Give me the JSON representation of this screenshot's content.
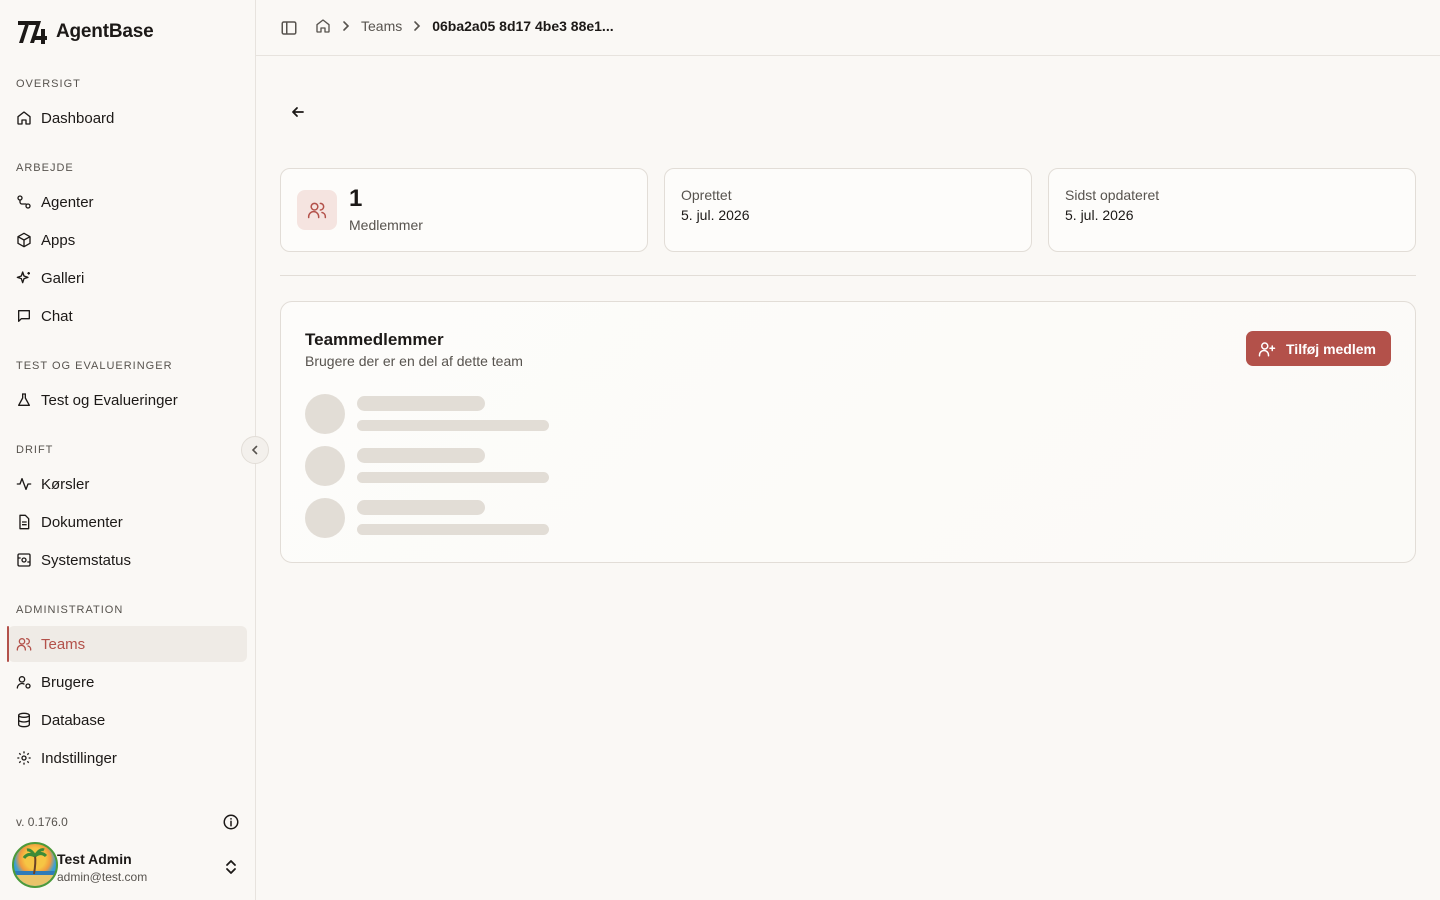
{
  "app": {
    "name": "AgentBase"
  },
  "sidebar": {
    "sections": [
      {
        "label": "OVERSIGT",
        "items": [
          {
            "label": "Dashboard",
            "icon": "home-icon"
          }
        ]
      },
      {
        "label": "ARBEJDE",
        "items": [
          {
            "label": "Agenter",
            "icon": "agents-icon"
          },
          {
            "label": "Apps",
            "icon": "box-icon"
          },
          {
            "label": "Galleri",
            "icon": "sparkles-icon"
          },
          {
            "label": "Chat",
            "icon": "message-icon"
          }
        ]
      },
      {
        "label": "TEST OG EVALUERINGER",
        "items": [
          {
            "label": "Test og Evalueringer",
            "icon": "flask-icon"
          }
        ]
      },
      {
        "label": "DRIFT",
        "items": [
          {
            "label": "Kørsler",
            "icon": "activity-icon"
          },
          {
            "label": "Dokumenter",
            "icon": "document-icon"
          },
          {
            "label": "Systemstatus",
            "icon": "status-icon"
          }
        ]
      },
      {
        "label": "ADMINISTRATION",
        "items": [
          {
            "label": "Teams",
            "icon": "users-icon",
            "active": true
          },
          {
            "label": "Brugere",
            "icon": "user-cog-icon"
          },
          {
            "label": "Database",
            "icon": "database-icon"
          },
          {
            "label": "Indstillinger",
            "icon": "gear-icon"
          }
        ]
      }
    ],
    "version": "v. 0.176.0",
    "user": {
      "name": "Test Admin",
      "email": "admin@test.com"
    }
  },
  "header": {
    "breadcrumb": {
      "teams": "Teams",
      "current": "06ba2a05 8d17 4be3 88e1..."
    }
  },
  "stats": {
    "members_count": "1",
    "members_label": "Medlemmer",
    "created_label": "Oprettet",
    "created_value": "5. jul. 2026",
    "updated_label": "Sidst opdateret",
    "updated_value": "5. jul. 2026"
  },
  "members": {
    "title": "Teammedlemmer",
    "subtitle": "Brugere der er en del af dette team",
    "add_button": "Tilføj medlem"
  },
  "colors": {
    "accent": "#b3514a",
    "background": "#faf8f5",
    "skeleton": "#e2ddd6"
  }
}
